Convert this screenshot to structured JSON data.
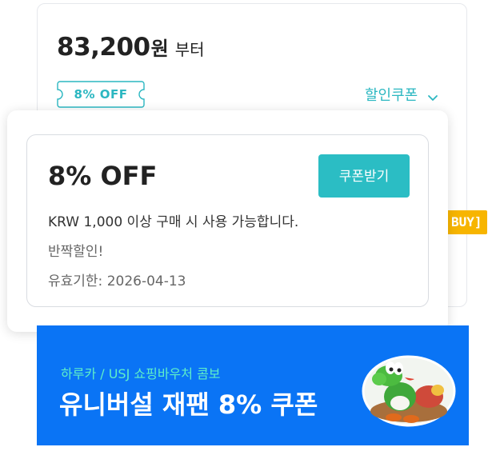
{
  "price": {
    "amount": "83,200",
    "currency": "원",
    "suffix": "부터"
  },
  "discount_tag": {
    "label": "8% OFF"
  },
  "coupon_dropdown": {
    "label": "할인쿠폰"
  },
  "badge": {
    "label": "BUY]"
  },
  "coupon": {
    "title": "8% OFF",
    "button_label": "쿠폰받기",
    "condition": "KRW 1,000 이상 구매 시 사용 가능합니다.",
    "name": "반짝할인!",
    "expiry": "유효기한: 2026-04-13"
  },
  "banner": {
    "subtitle": "하루카 / USJ 쇼핑바우처 콤보",
    "title": "유니버설 재팬 8% 쿠폰",
    "image_icon": "yoshi-character-image"
  },
  "colors": {
    "accent_teal": "#2bbdc4",
    "banner_blue": "#0a74f5",
    "banner_subtitle": "#5ff0c8",
    "badge_yellow": "#f7b500"
  }
}
